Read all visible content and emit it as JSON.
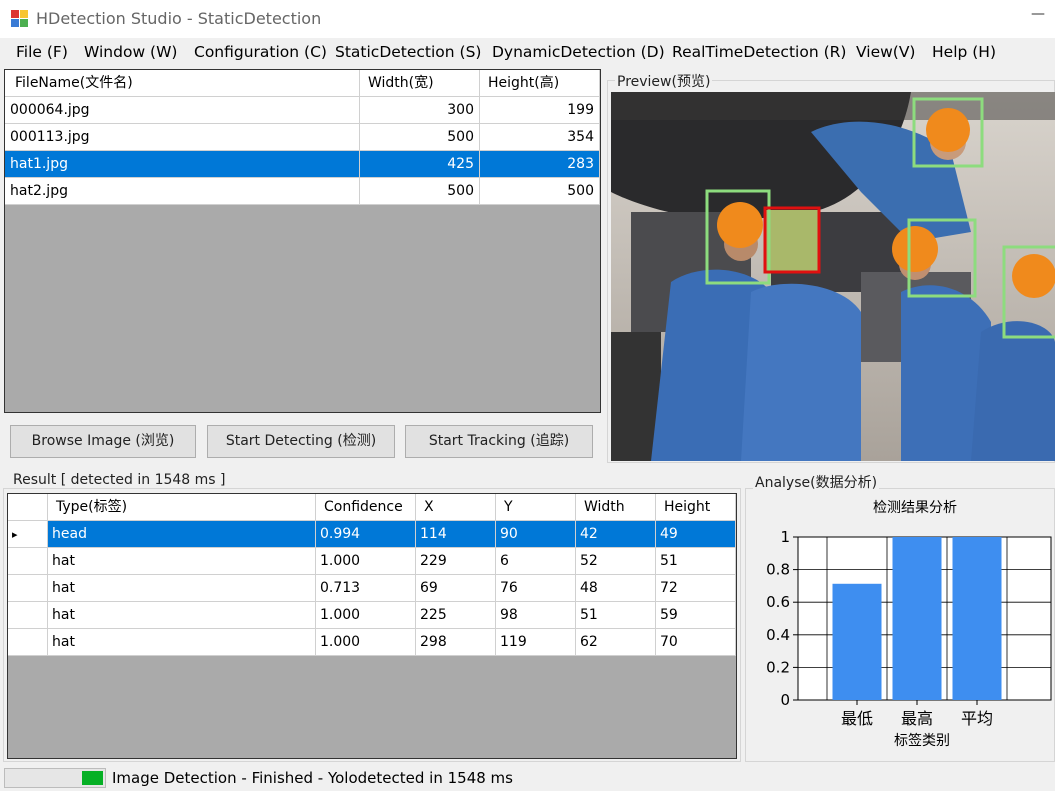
{
  "window": {
    "title": "HDetection Studio - StaticDetection",
    "minimize_glyph": "—"
  },
  "menu": [
    "File (F)",
    "Window (W)",
    "Configuration (C)",
    "StaticDetection (S)",
    "DynamicDetection (D)",
    "RealTimeDetection (R)",
    "View(V)",
    "Help (H)"
  ],
  "file_grid": {
    "headers": [
      "FileName(文件名)",
      "Width(宽)",
      "Height(高)"
    ],
    "rows": [
      [
        "000064.jpg",
        "300",
        "199"
      ],
      [
        "000113.jpg",
        "500",
        "354"
      ],
      [
        "hat1.jpg",
        "425",
        "283"
      ],
      [
        "hat2.jpg",
        "500",
        "500"
      ]
    ],
    "selected_index": 2
  },
  "buttons": {
    "browse": "Browse Image (浏览)",
    "detect": "Start Detecting (检测)",
    "track": "Start Tracking (追踪)"
  },
  "preview": {
    "label": "Preview(预览)",
    "box_colors": {
      "hat": "#8ddc7e",
      "head": "#e01010"
    }
  },
  "result": {
    "label": "Result [ detected in 1548 ms ]",
    "headers": [
      "Type(标签)",
      "Confidence",
      "X",
      "Y",
      "Width",
      "Height"
    ],
    "rows": [
      [
        "head",
        "0.994",
        "114",
        "90",
        "42",
        "49"
      ],
      [
        "hat",
        "1.000",
        "229",
        "6",
        "52",
        "51"
      ],
      [
        "hat",
        "0.713",
        "69",
        "76",
        "48",
        "72"
      ],
      [
        "hat",
        "1.000",
        "225",
        "98",
        "51",
        "59"
      ],
      [
        "hat",
        "1.000",
        "298",
        "119",
        "62",
        "70"
      ]
    ],
    "selected_index": 0,
    "row_indicator": "▸"
  },
  "analyse": {
    "label": "Analyse(数据分析)"
  },
  "chart_data": {
    "type": "bar",
    "title": "检测结果分析",
    "xlabel": "标签类别",
    "ylabel": "",
    "categories": [
      "最低",
      "最高",
      "平均"
    ],
    "values": [
      0.713,
      1.0,
      1.0
    ],
    "ylim": [
      0,
      1
    ],
    "yticks": [
      "0",
      "0.2",
      "0.4",
      "0.6",
      "0.8",
      "1"
    ],
    "bar_color": "#3e8ef0",
    "grid": true
  },
  "status": {
    "text": "Image Detection - Finished - Yolodetected in 1548 ms",
    "progress": 0.22,
    "progress_color": "#06b025"
  }
}
